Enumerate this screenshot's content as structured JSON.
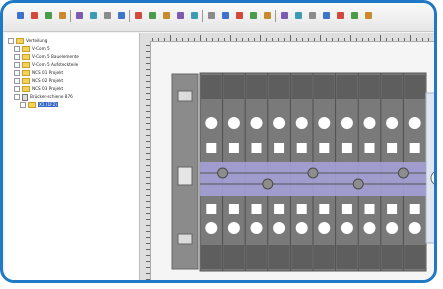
{
  "tree": {
    "items": [
      {
        "label": "Verteilung",
        "level": 0,
        "kind": "root"
      },
      {
        "label": "V-Com 5",
        "level": 1,
        "kind": "folder"
      },
      {
        "label": "V-Com 5 Bauelemente",
        "level": 1,
        "kind": "folder"
      },
      {
        "label": "V-Com 5 Aufsteckteile",
        "level": 1,
        "kind": "folder"
      },
      {
        "label": "NCS 01 Projekt",
        "level": 1,
        "kind": "folder"
      },
      {
        "label": "NCS 02 Projekt",
        "level": 1,
        "kind": "folder"
      },
      {
        "label": "NCS 03 Projekt",
        "level": 1,
        "kind": "folder"
      },
      {
        "label": "Brücker-schiene 876",
        "level": 1,
        "kind": "doc"
      },
      {
        "label": "X1 (1F2)",
        "level": 2,
        "kind": "folder",
        "selected": true
      }
    ]
  },
  "colors": {
    "frame": "#1f79c4",
    "terminal": "#777777",
    "terminal_dark": "#555555",
    "bridge": "#a7a3dd",
    "selection": "#3969c7"
  },
  "icons": [
    "new-icon",
    "open-icon",
    "save-icon",
    "print-icon",
    "cut-icon",
    "copy-icon",
    "paste-icon",
    "delete-icon",
    "zoom-in-icon",
    "zoom-out-icon",
    "grid-icon",
    "snap-icon",
    "move-icon",
    "undo-icon",
    "redo-icon",
    "arrow-icon",
    "line-icon",
    "rect-icon",
    "text-icon",
    "dimension-icon",
    "draw-icon",
    "edit-icon",
    "color-icon",
    "layer-icon",
    "properties-icon"
  ],
  "drawing": {
    "terminal_count": 10
  }
}
